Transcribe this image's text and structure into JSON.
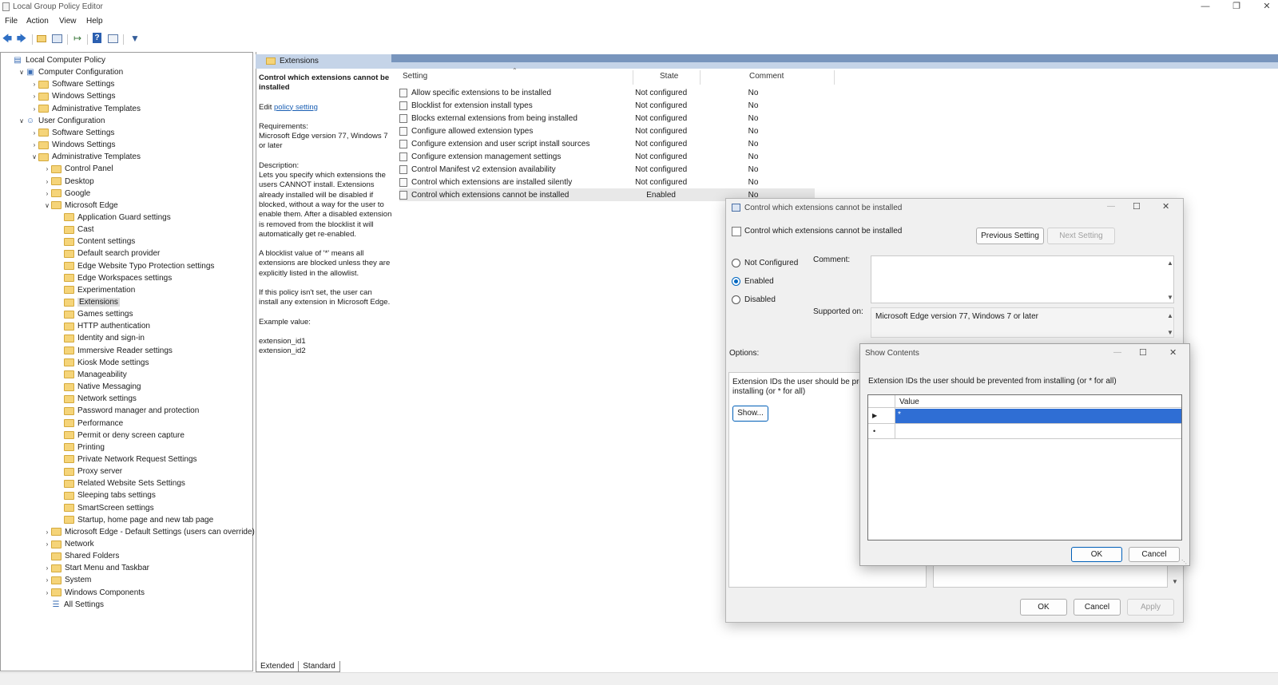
{
  "window": {
    "title": "Local Group Policy Editor",
    "minimize_icon": "minimize-icon",
    "restore_icon": "restore-icon",
    "close_icon": "close-icon"
  },
  "menu": [
    "File",
    "Action",
    "View",
    "Help"
  ],
  "toolbar_icons": [
    "back-arrow-icon",
    "forward-arrow-icon",
    "up-folder-icon",
    "show-hide-tree-icon",
    "export-list-icon",
    "help-icon",
    "properties-icon",
    "filter-icon"
  ],
  "tree": {
    "root": "Local Computer Policy",
    "computer_configuration": "Computer Configuration",
    "cc_items": [
      "Software Settings",
      "Windows Settings",
      "Administrative Templates"
    ],
    "user_configuration": "User Configuration",
    "uc_items": [
      "Software Settings",
      "Windows Settings",
      "Administrative Templates"
    ],
    "admin_children": [
      "Control Panel",
      "Desktop",
      "Google",
      "Microsoft Edge"
    ],
    "edge_children": [
      "Application Guard settings",
      "Cast",
      "Content settings",
      "Default search provider",
      "Edge Website Typo Protection settings",
      "Edge Workspaces settings",
      "Experimentation",
      "Extensions",
      "Games settings",
      "HTTP authentication",
      "Identity and sign-in",
      "Immersive Reader settings",
      "Kiosk Mode settings",
      "Manageability",
      "Native Messaging",
      "Network settings",
      "Password manager and protection",
      "Performance",
      "Permit or deny screen capture",
      "Printing",
      "Private Network Request Settings",
      "Proxy server",
      "Related Website Sets Settings",
      "Sleeping tabs settings",
      "SmartScreen settings",
      "Startup, home page and new tab page"
    ],
    "admin_tail": [
      "Microsoft Edge - Default Settings (users can override)",
      "Network",
      "Shared Folders",
      "Start Menu and Taskbar",
      "System",
      "Windows Components",
      "All Settings"
    ]
  },
  "main": {
    "header": "Extensions",
    "description": {
      "title": "Control which extensions cannot be installed",
      "edit_prefix": "Edit ",
      "edit_link": "policy setting",
      "requirements_label": "Requirements:",
      "requirements": "Microsoft Edge version 77, Windows 7 or later",
      "description_label": "Description:",
      "description": "Lets you specify which extensions the users CANNOT install. Extensions already installed will be disabled if blocked, without a way for the user to enable them. After a disabled extension is removed from the blocklist it will automatically get re-enabled.",
      "blocklist_note": "A blocklist value of '*' means all extensions are blocked unless they are explicitly listed in the allowlist.",
      "unset_note": "If this policy isn't set, the user can install any extension in Microsoft Edge.",
      "example_label": "Example value:",
      "example_1": "extension_id1",
      "example_2": "extension_id2"
    },
    "columns": {
      "setting": "Setting",
      "state": "State",
      "comment": "Comment"
    },
    "rows": [
      {
        "name": "Allow specific extensions to be installed",
        "state": "Not configured",
        "comment": "No"
      },
      {
        "name": "Blocklist for extension install types",
        "state": "Not configured",
        "comment": "No"
      },
      {
        "name": "Blocks external extensions from being installed",
        "state": "Not configured",
        "comment": "No"
      },
      {
        "name": "Configure allowed extension types",
        "state": "Not configured",
        "comment": "No"
      },
      {
        "name": "Configure extension and user script install sources",
        "state": "Not configured",
        "comment": "No"
      },
      {
        "name": "Configure extension management settings",
        "state": "Not configured",
        "comment": "No"
      },
      {
        "name": "Control Manifest v2 extension availability",
        "state": "Not configured",
        "comment": "No"
      },
      {
        "name": "Control which extensions are installed silently",
        "state": "Not configured",
        "comment": "No"
      },
      {
        "name": "Control which extensions cannot be installed",
        "state": "Enabled",
        "comment": "No"
      }
    ],
    "tabs": [
      "Extended",
      "Standard"
    ]
  },
  "policy_dialog": {
    "title": "Control which extensions cannot be installed",
    "subtitle": "Control which extensions cannot be installed",
    "prev_button": "Previous Setting",
    "next_button": "Next Setting",
    "radio_not_configured": "Not Configured",
    "radio_enabled": "Enabled",
    "radio_disabled": "Disabled",
    "comment_label": "Comment:",
    "supported_label": "Supported on:",
    "supported_value": "Microsoft Edge version 77, Windows 7 or later",
    "options_label": "Options:",
    "option_text": "Extension IDs the user should be prevented from installing (or * for all)",
    "show_button": "Show...",
    "ok": "OK",
    "cancel": "Cancel",
    "apply": "Apply"
  },
  "show_contents": {
    "title": "Show Contents",
    "instructions": "Extension IDs the user should be prevented from installing (or * for all)",
    "column": "Value",
    "row1_value": "*",
    "ok": "OK",
    "cancel": "Cancel"
  }
}
